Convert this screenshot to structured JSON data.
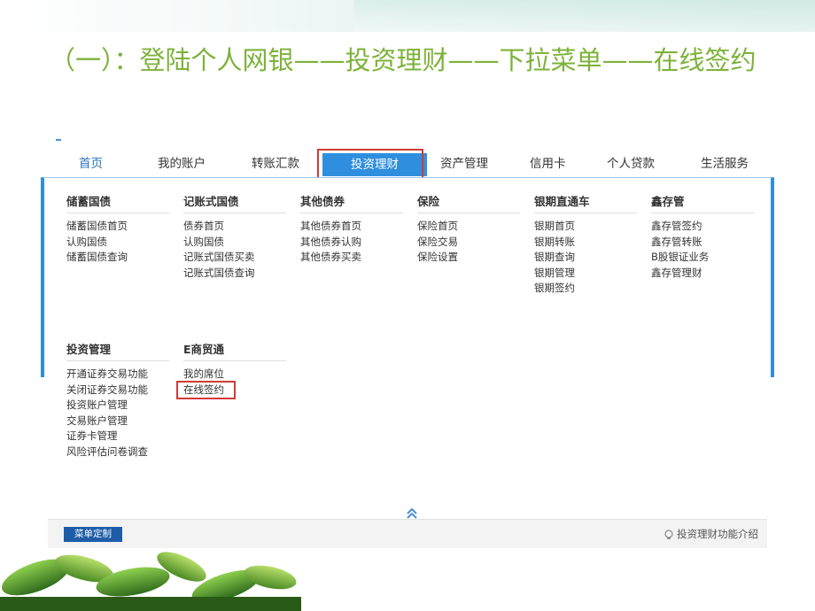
{
  "slide": {
    "title": "（一）：登陆个人网银——投资理财——下拉菜单——在线签约"
  },
  "nav": {
    "items": [
      "首页",
      "我的账户",
      "转账汇款",
      "投资理财",
      "资产管理",
      "信用卡",
      "个人贷款",
      "生活服务"
    ],
    "active_index": 3
  },
  "menu": {
    "columns": [
      {
        "title": "储蓄国债",
        "items": [
          "储蓄国债首页",
          "认购国债",
          "储蓄国债查询"
        ]
      },
      {
        "title": "记账式国债",
        "items": [
          "债券首页",
          "认购国债",
          "记账式国债买卖",
          "记账式国债查询"
        ]
      },
      {
        "title": "其他债券",
        "items": [
          "其他债券首页",
          "其他债券认购",
          "其他债券买卖"
        ]
      },
      {
        "title": "保险",
        "items": [
          "保险首页",
          "保险交易",
          "保险设置"
        ]
      },
      {
        "title": "银期直通车",
        "items": [
          "银期首页",
          "银期转账",
          "银期查询",
          "银期管理",
          "银期签约"
        ]
      },
      {
        "title": "鑫存管",
        "items": [
          "鑫存管签约",
          "鑫存管转账",
          "B股银证业务",
          "鑫存管理财"
        ]
      },
      {
        "title": "投资管理",
        "items": [
          "开通证券交易功能",
          "关闭证券交易功能",
          "投资账户管理",
          "交易账户管理",
          "证券卡管理",
          "风险评估问卷调查"
        ]
      },
      {
        "title": "E商贸通",
        "items": [
          "我的席位",
          "在线签约"
        ]
      }
    ]
  },
  "footer": {
    "custom_button": "菜单定制",
    "intro_link": "投资理财功能介绍"
  },
  "colors": {
    "title_green": "#7db23a",
    "nav_active": "#2f8fde",
    "highlight_red": "#d23a3a",
    "footer_button": "#1d5da8"
  }
}
